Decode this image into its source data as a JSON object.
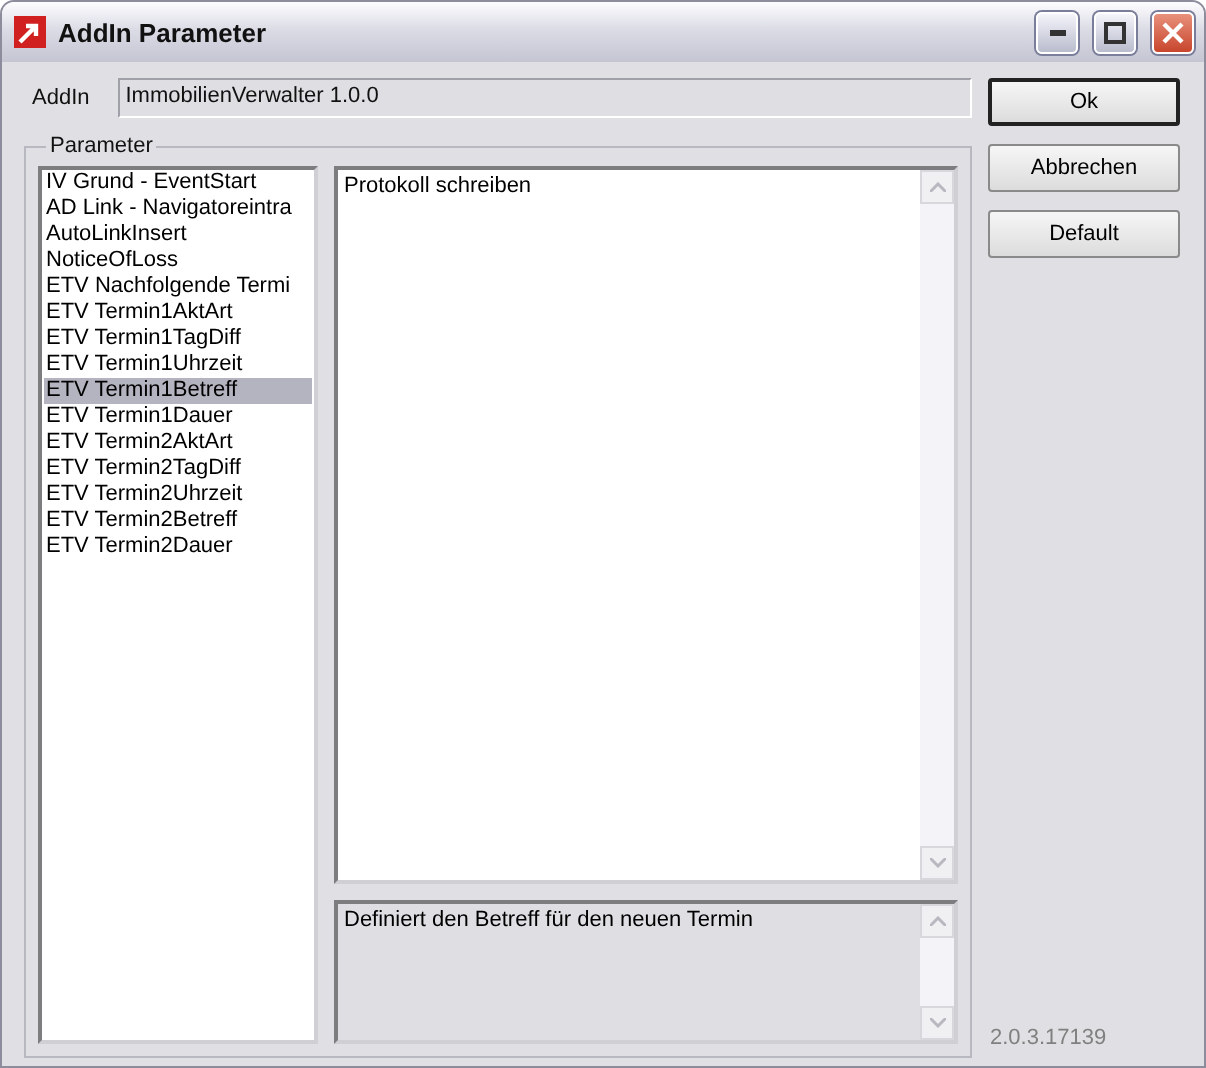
{
  "window": {
    "title": "AddIn Parameter"
  },
  "addin": {
    "label": "AddIn",
    "value": "ImmobilienVerwalter 1.0.0"
  },
  "buttons": [
    {
      "label": "Ok",
      "default": true
    },
    {
      "label": "Abbrechen",
      "default": false
    },
    {
      "label": "Default",
      "default": false
    }
  ],
  "parameter_group": {
    "title": "Parameter",
    "items": [
      {
        "label": "IV Grund - EventStart",
        "selected": false
      },
      {
        "label": "AD Link - Navigatoreintra",
        "selected": false
      },
      {
        "label": "AutoLinkInsert",
        "selected": false
      },
      {
        "label": "NoticeOfLoss",
        "selected": false
      },
      {
        "label": "ETV Nachfolgende Termi",
        "selected": false
      },
      {
        "label": "ETV Termin1AktArt",
        "selected": false
      },
      {
        "label": "ETV Termin1TagDiff",
        "selected": false
      },
      {
        "label": "ETV Termin1Uhrzeit",
        "selected": false
      },
      {
        "label": "ETV Termin1Betreff",
        "selected": true
      },
      {
        "label": "ETV Termin1Dauer",
        "selected": false
      },
      {
        "label": "ETV Termin2AktArt",
        "selected": false
      },
      {
        "label": "ETV Termin2TagDiff",
        "selected": false
      },
      {
        "label": "ETV Termin2Uhrzeit",
        "selected": false
      },
      {
        "label": "ETV Termin2Betreff",
        "selected": false
      },
      {
        "label": "ETV Termin2Dauer",
        "selected": false
      }
    ],
    "value": "Protokoll schreiben",
    "description": "Definiert den Betreff für den neuen Termin"
  },
  "version": "2.0.3.17139"
}
